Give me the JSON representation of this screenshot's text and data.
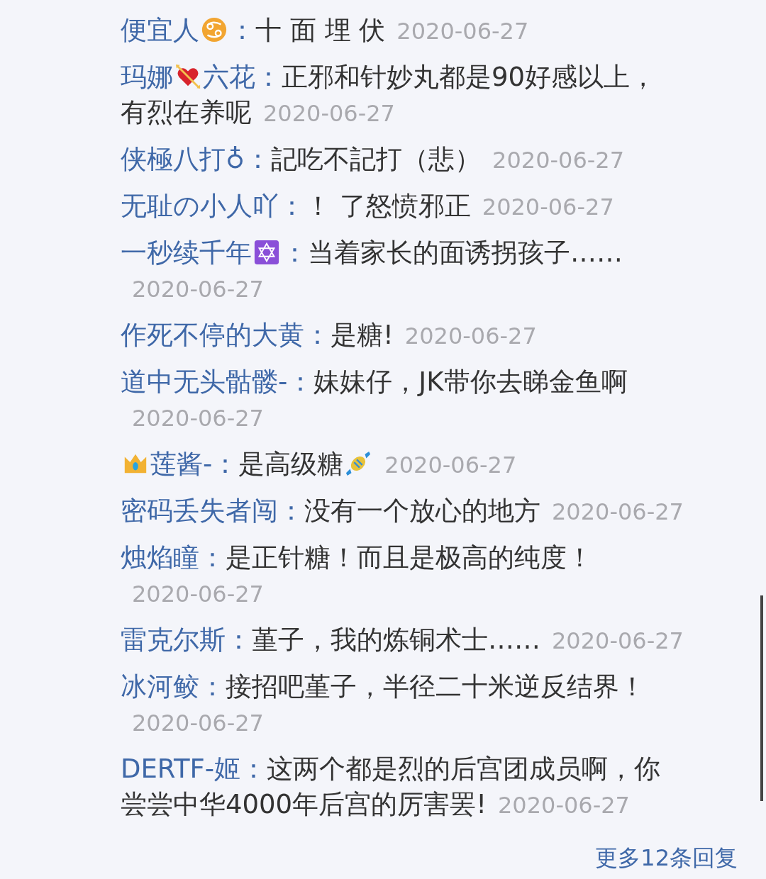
{
  "replies": [
    {
      "parts": [
        {
          "kind": "name",
          "text": "便宜人"
        },
        {
          "kind": "zodiac"
        },
        {
          "kind": "name",
          "text": "："
        },
        {
          "kind": "comment",
          "text": "十 面 埋 伏"
        },
        {
          "kind": "date",
          "text": "2020-06-27"
        }
      ]
    },
    {
      "parts": [
        {
          "kind": "name",
          "text": "玛娜"
        },
        {
          "kind": "heart"
        },
        {
          "kind": "name",
          "text": "六花："
        },
        {
          "kind": "comment",
          "text": "正邪和针妙丸都是90好感以上，"
        },
        {
          "kind": "comment",
          "text": "有烈在养呢"
        },
        {
          "kind": "date",
          "text": "2020-06-27"
        }
      ]
    },
    {
      "parts": [
        {
          "kind": "name",
          "text": "侠極八打♁："
        },
        {
          "kind": "comment",
          "text": "記吃不記打（悲）"
        },
        {
          "kind": "date",
          "text": "2020-06-27"
        }
      ]
    },
    {
      "parts": [
        {
          "kind": "name",
          "text": "无耻の小人吖："
        },
        {
          "kind": "comment",
          "text": "！ 了怒愤邪正"
        },
        {
          "kind": "date",
          "text": "2020-06-27"
        }
      ]
    },
    {
      "parts": [
        {
          "kind": "name",
          "text": "一秒续千年"
        },
        {
          "kind": "hexagram"
        },
        {
          "kind": "name",
          "text": "："
        },
        {
          "kind": "comment",
          "text": "当着家长的面诱拐孩子……"
        },
        {
          "kind": "date",
          "text": "2020-06-27"
        }
      ]
    },
    {
      "parts": [
        {
          "kind": "name",
          "text": "作死不停的大黄："
        },
        {
          "kind": "comment",
          "text": "是糖!"
        },
        {
          "kind": "date",
          "text": "2020-06-27"
        }
      ]
    },
    {
      "parts": [
        {
          "kind": "name",
          "text": "道中无头骷髅-："
        },
        {
          "kind": "comment",
          "text": "妹妹仔，JK带你去睇金鱼啊"
        },
        {
          "kind": "date",
          "text": "2020-06-27"
        }
      ]
    },
    {
      "parts": [
        {
          "kind": "crown"
        },
        {
          "kind": "name",
          "text": "莲酱-："
        },
        {
          "kind": "comment",
          "text": "是高级糖"
        },
        {
          "kind": "candy"
        },
        {
          "kind": "date",
          "text": "2020-06-27"
        }
      ]
    },
    {
      "parts": [
        {
          "kind": "name",
          "text": "密码丢失者闯："
        },
        {
          "kind": "comment",
          "text": "没有一个放心的地方"
        },
        {
          "kind": "date",
          "text": "2020-06-27"
        }
      ]
    },
    {
      "parts": [
        {
          "kind": "name",
          "text": "烛焰瞳："
        },
        {
          "kind": "comment",
          "text": "是正针糖！而且是极高的纯度！"
        },
        {
          "kind": "date",
          "text": "2020-06-27"
        }
      ]
    },
    {
      "parts": [
        {
          "kind": "name",
          "text": "雷克尔斯："
        },
        {
          "kind": "comment",
          "text": "堇子，我的炼铜术士……"
        },
        {
          "kind": "date",
          "text": "2020-06-27"
        }
      ]
    },
    {
      "parts": [
        {
          "kind": "name",
          "text": "冰河鲛："
        },
        {
          "kind": "comment",
          "text": "接招吧堇子，半径二十米逆反结界！"
        },
        {
          "kind": "date",
          "text": "2020-06-27"
        }
      ]
    },
    {
      "parts": [
        {
          "kind": "name",
          "text": "DERTF-姬："
        },
        {
          "kind": "comment",
          "text": "这两个都是烈的后宫团成员啊，你"
        },
        {
          "kind": "comment",
          "text": "尝尝中华4000年后宫的厉害罢!"
        },
        {
          "kind": "date",
          "text": "2020-06-27"
        }
      ]
    }
  ],
  "more_link": "更多12条回复"
}
